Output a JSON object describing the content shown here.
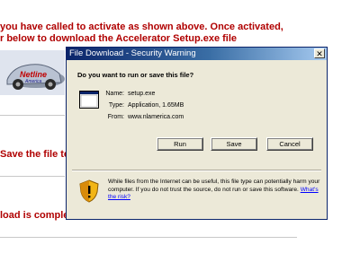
{
  "webpage": {
    "line1": "you have called to activate as shown above. Once activated,",
    "line2": "r below to download the Accelerator Setup.exe file",
    "step_save": "Save the file to",
    "step_done": "load is complete click Run",
    "logo_text": "Netline America"
  },
  "dialog": {
    "title": "File Download - Security Warning",
    "close_glyph": "✕",
    "question": "Do you want to run or save this file?",
    "name_label": "Name:",
    "name_value": "setup.exe",
    "type_label": "Type:",
    "type_value": "Application, 1.65MB",
    "from_label": "From:",
    "from_value": "www.nlamerica.com",
    "buttons": {
      "run": "Run",
      "save": "Save",
      "cancel": "Cancel"
    },
    "warning_text": "While files from the Internet can be useful, this file type can potentially harm your computer. If you do not trust the source, do not run or save this software.",
    "warning_link": "What's the risk?"
  },
  "colors": {
    "accent_text": "#b00000",
    "title_bar": "#0a246a",
    "dialog_bg": "#ece9d8"
  }
}
